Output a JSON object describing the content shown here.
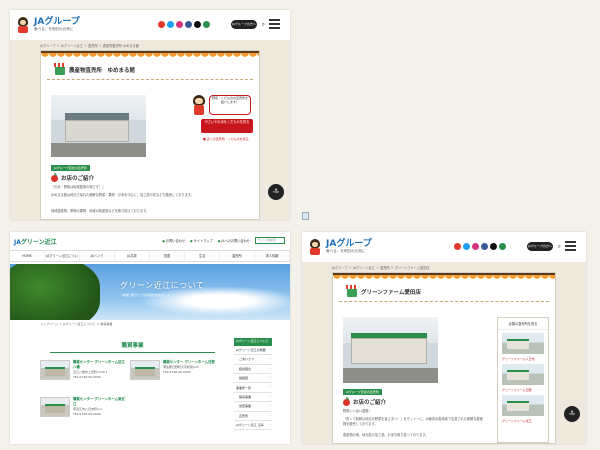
{
  "colors": {
    "ja_blue": "#1b6fb5",
    "ja_green": "#2a8f4a",
    "ja_red": "#c8161d",
    "page_bg": "#f4f1ea"
  },
  "screen1": {
    "logo": "JAグループ",
    "tagline": "食べる、を明日の元気に",
    "login": "JAグループの方へ",
    "breadcrumb": "JAグループ ＞ JAグリーン近江 ＞ 直売所 ＞ 農産物直売所 ゆめまる館",
    "shop_name": "農産物直売所　ゆめまる館",
    "bubble": "野菜・くだものの直売所を紹介します！",
    "cta": "やさいやお米をくだものを見る",
    "link": "■ 近くの直売所・くだものを見る",
    "badge": "JAグループ直営の直売所",
    "intro": "お店のご紹介",
    "body1": "「お米・野菜は地域農家の味です！」",
    "body2": "ゆめまる館は地元で採れた新鮮な野菜・果物・お米を中心に、加工品や花なども販売しております。",
    "body3": "地域農産物、季節の果物、地域の特産品などを取り揃えております。",
    "top": "TOP"
  },
  "screen2": {
    "logo_ja": "JA",
    "logo_rest": "グリーン近江",
    "links": [
      "お問い合わせ",
      "サイトマップ",
      "JAへのお問い合わせ"
    ],
    "search_placeholder": "サイト内検索",
    "nav": [
      "HOME",
      "JAグリーン近江について",
      "JAバンク",
      "JA共済",
      "営農",
      "生活",
      "直売所",
      "求人情報"
    ],
    "hero_title": "グリーン近江について",
    "hero_sub": "地域に根ざした協同組合をめざして",
    "breadcrumb": "トップページ ＞ JAグリーン近江について ＞ 購買事業",
    "section_title": "購買事業",
    "stores": [
      {
        "name": "購買センター グリーンホーム近江八幡",
        "addr": "近江八幡市上田町1234-1",
        "tel": "TEL:0748-00-0000"
      },
      {
        "name": "購買センター グリーンホーム日野",
        "addr": "蒲生郡日野町大字松尾123",
        "tel": "TEL:0748-00-0000"
      },
      {
        "name": "購買センター グリーンホーム東近江",
        "addr": "東近江市八日市町1-1",
        "tel": "TEL:0748-00-0000"
      }
    ],
    "side_head": "JAグリーン近江について",
    "side_items": [
      "JAグリーン近江の概要",
      "ごあいさつ",
      "経営理念",
      "組織図",
      "事業所一覧",
      "購買事業",
      "営農事業",
      "直売所",
      "JAグリーン近江 沿革"
    ]
  },
  "screen3": {
    "logo": "JAグループ",
    "tagline": "食べる、を明日の元気に",
    "login": "JAグループの方へ",
    "breadcrumb": "JAグループ ＞ JAグリーン近江 ＞ 直売所 ＞ グリーンファーム愛田店",
    "shop_name": "グリーンファーム愛田店",
    "badge": "JAグループ直営の直売所",
    "intro": "お店のご紹介",
    "body1": "野菜いっぱい直販！",
    "body2": "「安くて新鮮な地元の野菜を皆さまへ！」をモットーに、JA管内の各地域で生産された新鮮な農産物を販売しております。",
    "body3": "農産物の他、地元産の加工品、お米も取り扱っております。",
    "side_title": "近隣の直売所を見る",
    "nearby": [
      "グリーンファーム八日市",
      "グリーンファーム日野",
      "グリーンファーム竜王"
    ],
    "top": "TOP"
  }
}
